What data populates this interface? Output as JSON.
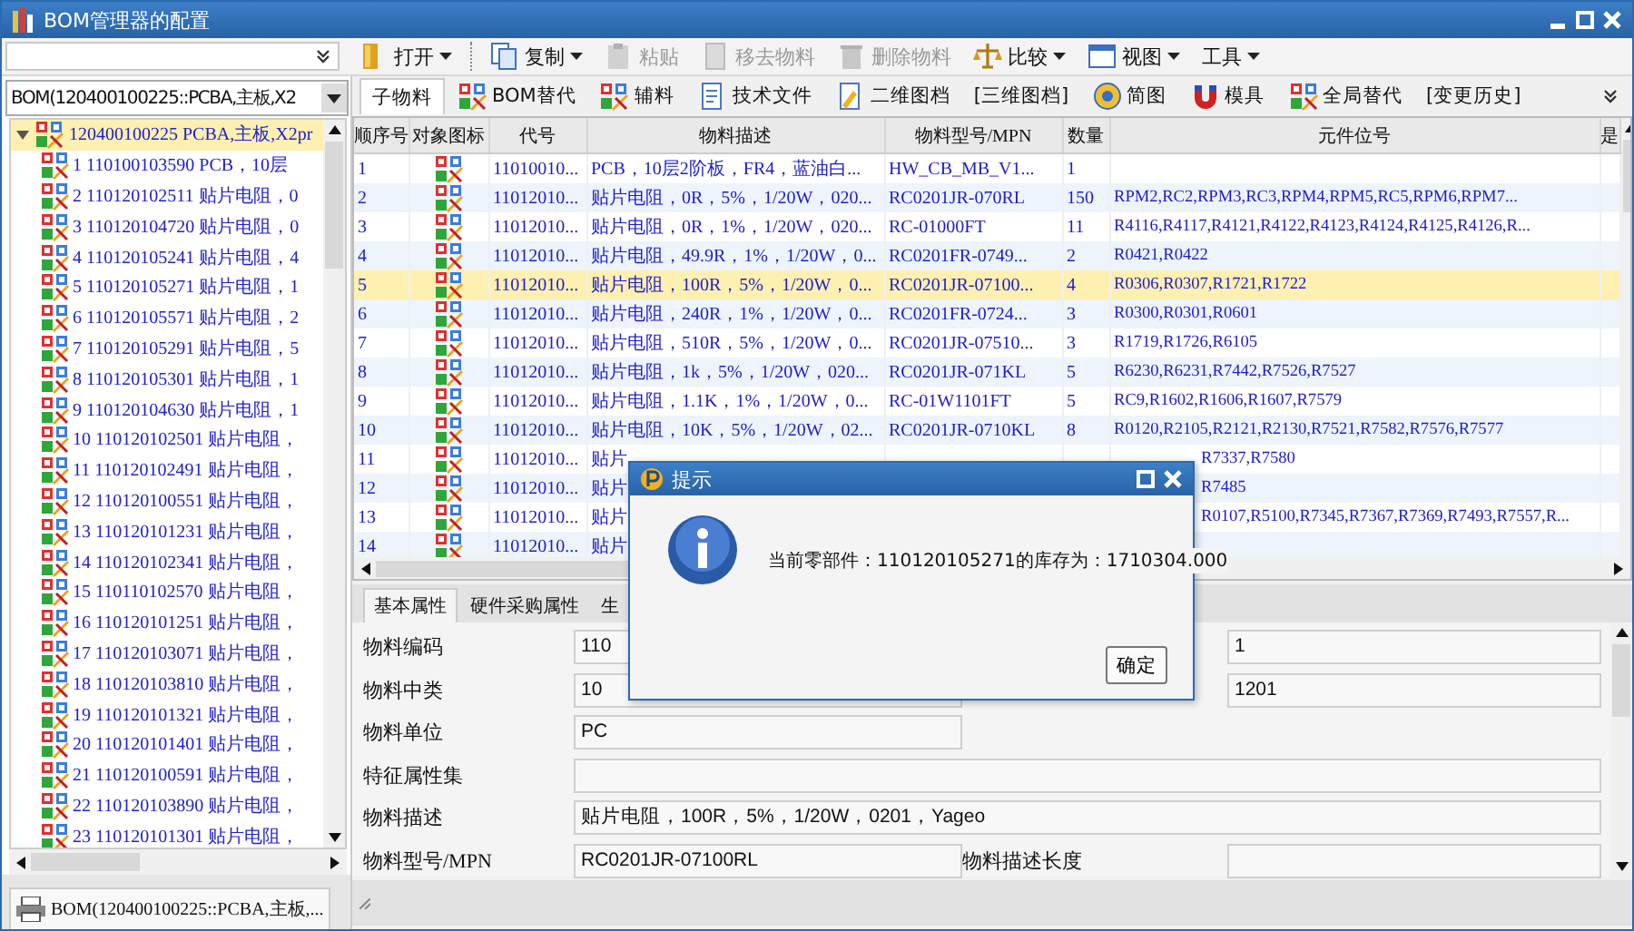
{
  "window": {
    "title": "BOM管理器的配置"
  },
  "toolbar": [
    {
      "label": "打开",
      "dropdown": true,
      "disabled": false
    },
    {
      "label": "复制",
      "dropdown": true,
      "disabled": false
    },
    {
      "label": "粘贴",
      "dropdown": false,
      "disabled": true
    },
    {
      "label": "移去物料",
      "dropdown": false,
      "disabled": true
    },
    {
      "label": "删除物料",
      "dropdown": false,
      "disabled": true
    },
    {
      "label": "比较",
      "dropdown": true,
      "disabled": false
    },
    {
      "label": "视图",
      "dropdown": true,
      "disabled": false
    },
    {
      "label": "工具",
      "dropdown": true,
      "disabled": false
    }
  ],
  "bom_selector": {
    "value": "BOM(120400100225::PCBA,主板,X2"
  },
  "tree": {
    "label": "120400100225 PCBA,主板,X2pr",
    "expanded": true,
    "selected": true,
    "children": [
      {
        "label": "1 110100103590 PCB，10层"
      },
      {
        "label": "2 110120102511 贴片电阻，0"
      },
      {
        "label": "3 110120104720 贴片电阻，0"
      },
      {
        "label": "4 110120105241 贴片电阻，4"
      },
      {
        "label": "5 110120105271 贴片电阻，1"
      },
      {
        "label": "6 110120105571 贴片电阻，2"
      },
      {
        "label": "7 110120105291 贴片电阻，5"
      },
      {
        "label": "8 110120105301 贴片电阻，1"
      },
      {
        "label": "9 110120104630 贴片电阻，1"
      },
      {
        "label": "10 110120102501 贴片电阻，"
      },
      {
        "label": "11 110120102491 贴片电阻，"
      },
      {
        "label": "12 110120100551 贴片电阻，"
      },
      {
        "label": "13 110120101231 贴片电阻，"
      },
      {
        "label": "14 110120102341 贴片电阻，"
      },
      {
        "label": "15 110110102570 贴片电阻，"
      },
      {
        "label": "16 110120101251 贴片电阻，"
      },
      {
        "label": "17 110120103071 贴片电阻，"
      },
      {
        "label": "18 110120103810 贴片电阻，"
      },
      {
        "label": "19 110120101321 贴片电阻，"
      },
      {
        "label": "20 110120101401 贴片电阻，"
      },
      {
        "label": "21 110120100591 贴片电阻，"
      },
      {
        "label": "22 110120103890 贴片电阻，"
      },
      {
        "label": "23 110120101301 贴片电阻，"
      }
    ]
  },
  "bottom_tab": {
    "label": "BOM(120400100225::PCBA,主板,..."
  },
  "tabs": [
    {
      "label": "子物料",
      "selected": true
    },
    {
      "label": "BOM替代",
      "selected": false
    },
    {
      "label": "辅料",
      "selected": false
    },
    {
      "label": "技术文件",
      "selected": false
    },
    {
      "label": "二维图档",
      "selected": false
    },
    {
      "label": "[三维图档]",
      "selected": false
    },
    {
      "label": "简图",
      "selected": false
    },
    {
      "label": "模具",
      "selected": false
    },
    {
      "label": "全局替代",
      "selected": false
    },
    {
      "label": "[变更历史]",
      "selected": false
    }
  ],
  "table": {
    "columns": [
      "顺序号",
      "对象图标",
      "代号",
      "物料描述",
      "物料型号/MPN",
      "数量",
      "元件位号",
      "是"
    ],
    "rows": [
      {
        "selected": false,
        "cells": [
          "1",
          "",
          "11010010...",
          "PCB，10层2阶板，FR4，蓝油白...",
          "HW_CB_MB_V1...",
          "1"
        ]
      },
      {
        "selected": false,
        "cells": [
          "2",
          "",
          "11012010...",
          "贴片电阻，0R，5%，1/20W，020...",
          "RC0201JR-070RL",
          "150",
          "RPM2,RC2,RPM3,RC3,RPM4,RPM5,RC5,RPM6,RPM7..."
        ]
      },
      {
        "selected": false,
        "cells": [
          "3",
          "",
          "11012010...",
          "贴片电阻，0R，1%，1/20W，020...",
          "RC-01000FT",
          "11",
          "R4116,R4117,R4121,R4122,R4123,R4124,R4125,R4126,R..."
        ]
      },
      {
        "selected": false,
        "cells": [
          "4",
          "",
          "11012010...",
          "贴片电阻，49.9R，1%，1/20W，0...",
          "RC0201FR-0749...",
          "2",
          "R0421,R0422"
        ]
      },
      {
        "selected": true,
        "cells": [
          "5",
          "",
          "11012010...",
          "贴片电阻，100R，5%，1/20W，0...",
          "RC0201JR-07100...",
          "4",
          "R0306,R0307,R1721,R1722"
        ]
      },
      {
        "selected": false,
        "cells": [
          "6",
          "",
          "11012010...",
          "贴片电阻，240R，1%，1/20W，0...",
          "RC0201FR-0724...",
          "3",
          "R0300,R0301,R0601"
        ]
      },
      {
        "selected": false,
        "cells": [
          "7",
          "",
          "11012010...",
          "贴片电阻，510R，5%，1/20W，0...",
          "RC0201JR-07510...",
          "3",
          "R1719,R1726,R6105"
        ]
      },
      {
        "selected": false,
        "cells": [
          "8",
          "",
          "11012010...",
          "贴片电阻，1k，5%，1/20W，020...",
          "RC0201JR-071KL",
          "5",
          "R6230,R6231,R7442,R7526,R7527"
        ]
      },
      {
        "selected": false,
        "cells": [
          "9",
          "",
          "11012010...",
          "贴片电阻，1.1K，1%，1/20W，0...",
          "RC-01W1101FT",
          "5",
          "RC9,R1602,R1606,R1607,R7579"
        ]
      },
      {
        "selected": false,
        "cells": [
          "10",
          "",
          "11012010...",
          "贴片电阻，10K，5%，1/20W，02...",
          "RC0201JR-0710KL",
          "8",
          "R0120,R2105,R2121,R2130,R7521,R7582,R7576,R7577"
        ]
      },
      {
        "selected": false,
        "cells": [
          "11",
          "",
          "11012010...",
          "贴片",
          "",
          "",
          "R7337,R7580"
        ]
      },
      {
        "selected": false,
        "cells": [
          "12",
          "",
          "11012010...",
          "贴片",
          "",
          "",
          "R7485"
        ]
      },
      {
        "selected": false,
        "cells": [
          "13",
          "",
          "11012010...",
          "贴片",
          "",
          "",
          "R0107,R5100,R7345,R7367,R7369,R7493,R7557,R..."
        ]
      },
      {
        "selected": false,
        "cells": [
          "14",
          "",
          "11012010...",
          "贴片"
        ]
      }
    ]
  },
  "form_tabs": [
    {
      "label": "基本属性",
      "selected": true
    },
    {
      "label": "硬件采购属性",
      "selected": false
    },
    {
      "label": "生",
      "selected": false
    }
  ],
  "form": [
    [
      {
        "kind": "half",
        "label": "物料编码",
        "value": "110"
      },
      {
        "kind": "half",
        "value": "1"
      }
    ],
    [
      {
        "kind": "half",
        "label": "物料中类",
        "value": "10"
      },
      {
        "kind": "half",
        "value": "1201"
      }
    ],
    [
      {
        "kind": "half",
        "label": "物料单位",
        "value": "PC"
      }
    ],
    [
      {
        "kind": "wide",
        "label": "特征属性集"
      }
    ],
    [
      {
        "kind": "wide",
        "label": "物料描述",
        "value": "贴片电阻，100R，5%，1/20W，0201，Yageo"
      }
    ],
    [
      {
        "kind": "half",
        "label": "物料型号/MPN",
        "value": "RC0201JR-07100RL"
      },
      {
        "kind": "half",
        "label": "物料描述长度"
      }
    ]
  ],
  "dialog": {
    "title": "提示",
    "message": "当前零部件：110120105271的库存为：1710304.000",
    "button": "确定"
  }
}
